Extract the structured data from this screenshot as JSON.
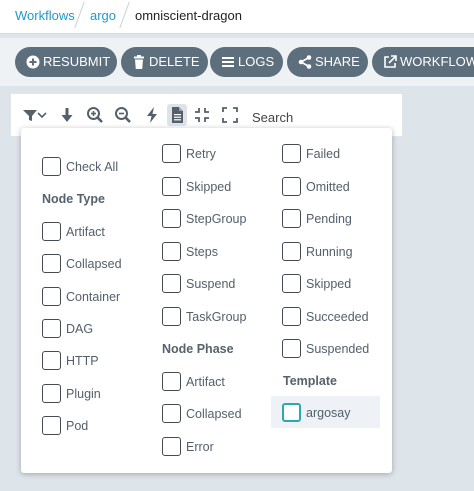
{
  "breadcrumb": {
    "items": [
      {
        "label": "Workflows"
      },
      {
        "label": "argo"
      },
      {
        "label": "omniscient-dragon"
      }
    ]
  },
  "actions": {
    "resubmit": "RESUBMIT",
    "delete": "DELETE",
    "logs": "LOGS",
    "share": "SHARE",
    "workflow_link": "WORKFLOW L"
  },
  "graph_toolbar": {
    "search_placeholder": "Search"
  },
  "filter": {
    "check_all": "Check All",
    "node_type_heading": "Node Type",
    "node_types": [
      "Artifact",
      "Collapsed",
      "Container",
      "DAG",
      "HTTP",
      "Plugin",
      "Pod",
      "Retry",
      "Skipped",
      "StepGroup",
      "Steps",
      "Suspend",
      "TaskGroup"
    ],
    "node_phase_heading": "Node Phase",
    "node_phases": [
      "Artifact",
      "Collapsed",
      "Error",
      "Failed",
      "Omitted",
      "Pending",
      "Running",
      "Skipped",
      "Succeeded",
      "Suspended"
    ],
    "template_heading": "Template",
    "templates": [
      "argosay"
    ]
  },
  "colors": {
    "link": "#1f9ac7",
    "button_bg": "#5d6e7c",
    "focus_ring": "#2fa6b5"
  }
}
